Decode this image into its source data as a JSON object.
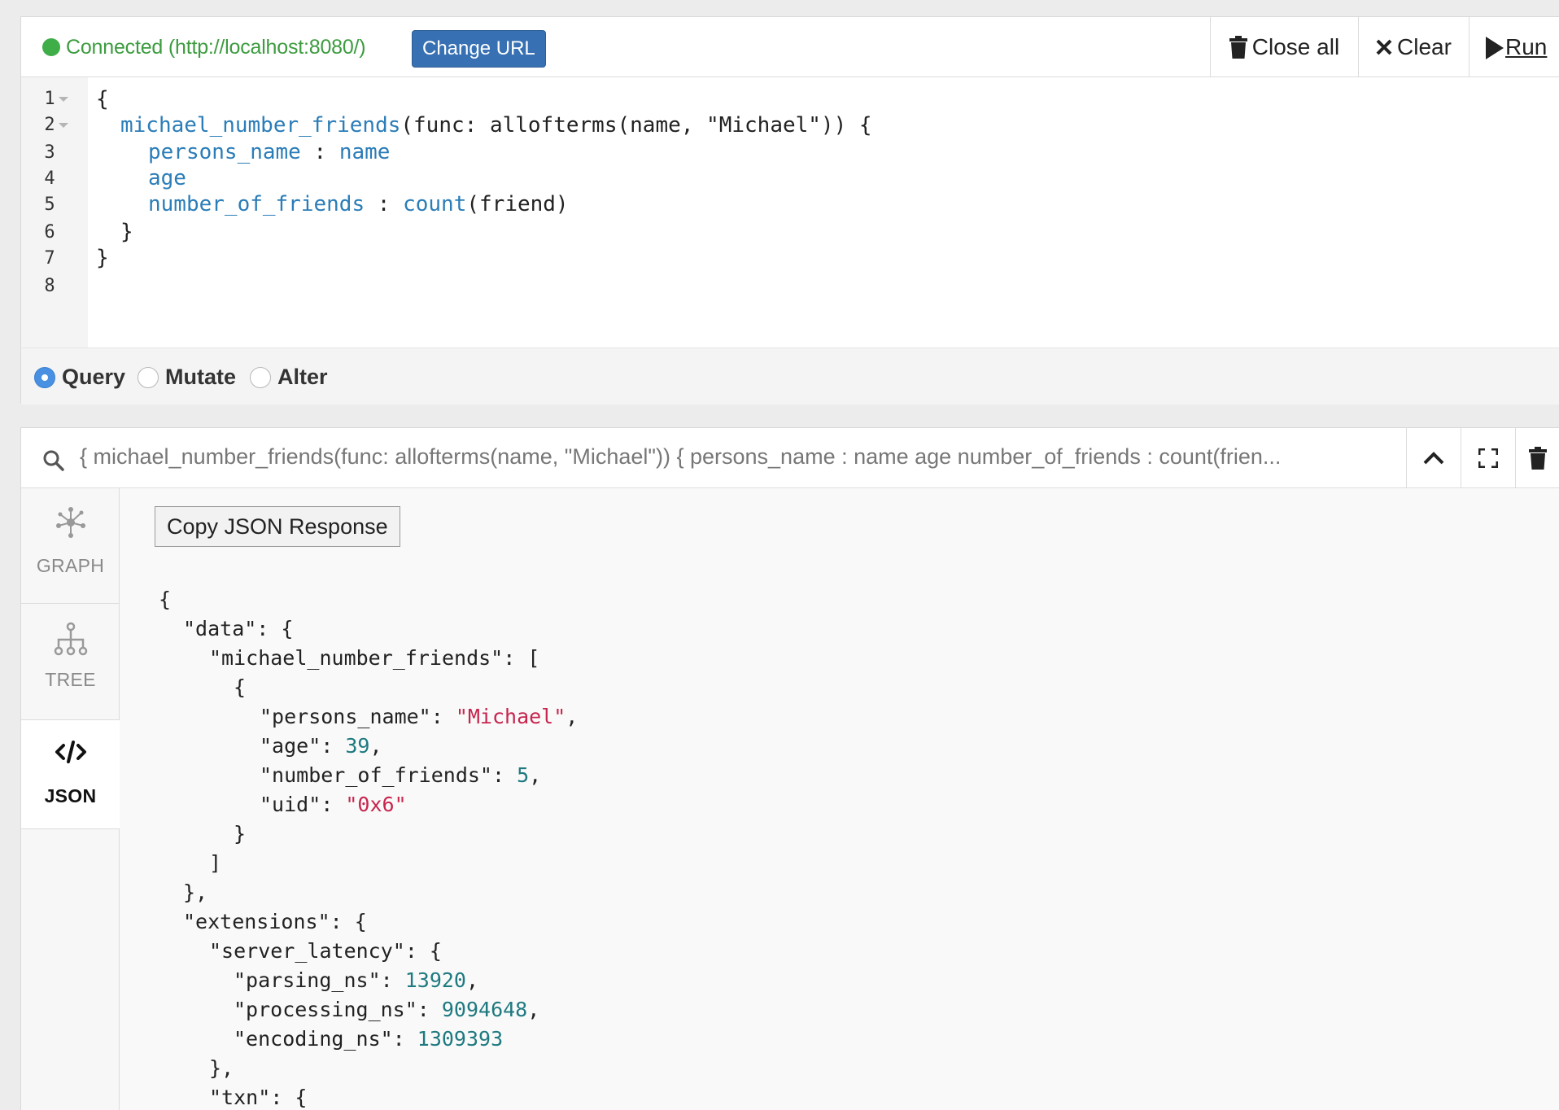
{
  "editor": {
    "status": {
      "text": "Connected (http://localhost:8080/)",
      "color": "#3fae49"
    },
    "change_url_label": "Change URL",
    "actions": {
      "close_all": "Close all",
      "clear": "Clear",
      "run": "Run"
    },
    "line_numbers": [
      "1",
      "2",
      "3",
      "4",
      "5",
      "6",
      "7",
      "8"
    ],
    "code": {
      "l1": "{",
      "l2_name": "michael_number_friends",
      "l2_rest": "(func: allofterms(name, \"Michael\")) {",
      "l3_field": "persons_name",
      "l3_sep": " : ",
      "l3_value": "name",
      "l4_field": "age",
      "l5_field": "number_of_friends",
      "l5_sep": " : ",
      "l5_fn": "count",
      "l5_rest": "(friend)",
      "l6": "}",
      "l7": "}"
    },
    "modes": [
      {
        "label": "Query",
        "selected": true
      },
      {
        "label": "Mutate",
        "selected": false
      },
      {
        "label": "Alter",
        "selected": false
      }
    ]
  },
  "result": {
    "query_summary": "{ michael_number_friends(func: allofterms(name, \"Michael\")) { persons_name : name age number_of_friends : count(frien...",
    "tabs": [
      {
        "label": "GRAPH",
        "icon": "graph-icon",
        "active": false
      },
      {
        "label": "TREE",
        "icon": "tree-icon",
        "active": false
      },
      {
        "label": "JSON",
        "icon": "code-icon",
        "active": true
      }
    ],
    "copy_button_label": "Copy JSON Response",
    "json": {
      "l1": "{",
      "l2": "\"data\": {",
      "l3": "\"michael_number_friends\": [",
      "l4": "{",
      "l5_key": "\"persons_name\": ",
      "l5_val": "\"Michael\"",
      "l6_key": "\"age\": ",
      "l6_val": "39",
      "l7_key": "\"number_of_friends\": ",
      "l7_val": "5",
      "l8_key": "\"uid\": ",
      "l8_val": "\"0x6\"",
      "l9": "}",
      "l10": "]",
      "l11": "},",
      "l12": "\"extensions\": {",
      "l13": "\"server_latency\": {",
      "l14_key": "\"parsing_ns\": ",
      "l14_val": "13920",
      "l15_key": "\"processing_ns\": ",
      "l15_val": "9094648",
      "l16_key": "\"encoding_ns\": ",
      "l16_val": "1309393",
      "l17": "},",
      "l18": "\"txn\": {"
    }
  }
}
